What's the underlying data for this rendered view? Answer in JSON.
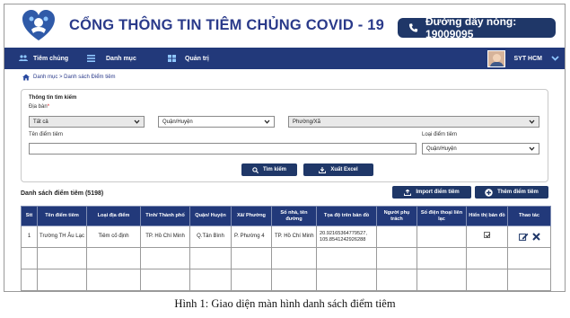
{
  "header": {
    "portal_title": "CỔNG THÔNG TIN TIÊM CHỦNG COVID - 19",
    "hotline": "Đường dây nóng: 19009095"
  },
  "nav": {
    "items": [
      {
        "label": "Tiêm chủng",
        "icon": "group-icon"
      },
      {
        "label": "Danh mục",
        "icon": "list-icon"
      },
      {
        "label": "Quản trị",
        "icon": "windows-icon"
      }
    ],
    "user": "SYT HCM"
  },
  "breadcrumb": "Danh mục > Danh sách Điểm tiêm",
  "search": {
    "title": "Thông tin tìm kiếm",
    "area_label": "Địa bàn",
    "required_mark": "*",
    "province_value": "Tất cả",
    "district_value": "Quận/Huyện",
    "ward_value": "Phường/Xã",
    "site_name_label": "Tên điểm tiêm",
    "site_name_value": "",
    "site_type_label": "Loại điểm tiêm",
    "site_type_value": "Quận/Huyện",
    "search_button": "Tìm kiếm",
    "export_button": "Xuất Excel"
  },
  "list": {
    "title": "Danh sách điểm tiêm (5198)",
    "import_button": "Import điểm tiêm",
    "add_button": "Thêm điểm tiêm",
    "columns": [
      "Stt",
      "Tên điểm tiêm",
      "Loại địa điểm",
      "Tỉnh/ Thành phố",
      "Quận/ Huyện",
      "Xã/ Phường",
      "Số nhà, tên đường",
      "Tọa độ trên bản đồ",
      "Người phụ trách",
      "Số điện thoại liên lạc",
      "Hiển thị bản đồ",
      "Thao tác"
    ],
    "rows": [
      {
        "stt": "1",
        "name": "Trường TH Âu Lạc",
        "type": "Tiêm cố định",
        "province": "TP. Hồ Chí Minh",
        "district": "Q.Tân Bình",
        "ward": "P. Phường 4",
        "street": "TP. Hồ Chí Minh",
        "coords": "20.92165364779527, 105.8541242926288",
        "person": "",
        "phone": "",
        "map_shown": true
      }
    ],
    "empty_rows": 3
  },
  "colors": {
    "navy": "#1f3768",
    "nav_bar": "#22397a",
    "title_blue": "#2a3a8a"
  },
  "caption": "Hình 1: Giao diện màn hình danh sách điểm tiêm"
}
